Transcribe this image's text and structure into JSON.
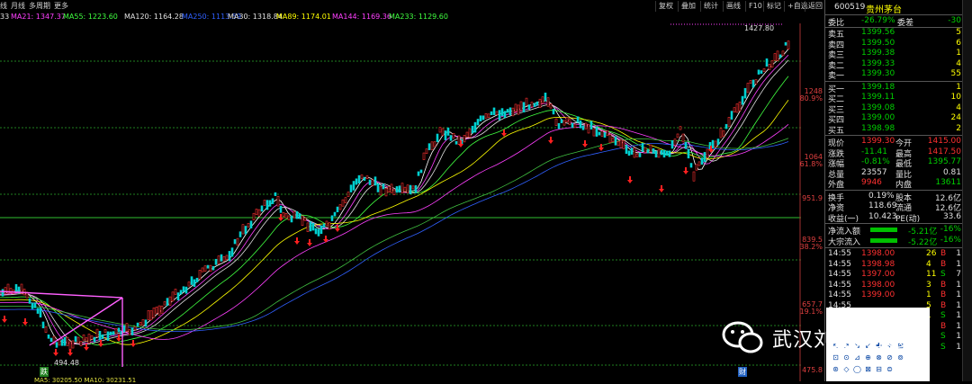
{
  "toolbar": {
    "items": [
      "线",
      "月线",
      "多周期",
      "更多"
    ],
    "right_buttons": [
      "复权",
      "叠加",
      "统计",
      "画线",
      "F10",
      "标记",
      "+自选",
      "返回"
    ]
  },
  "ma_legend": [
    {
      "label": "33",
      "color": "#e0e0e0"
    },
    {
      "label": "MA21: 1347.37",
      "color": "#ff40ff"
    },
    {
      "label": "MA55: 1223.60",
      "color": "#40ff40"
    },
    {
      "label": "MA120: 1164.28",
      "color": "#e0e0e0"
    },
    {
      "label": "MA250: 1113.59",
      "color": "#3060ff"
    },
    {
      "label": "MA30: 1318.84",
      "color": "#e0e0e0"
    },
    {
      "label": "MA89: 1174.01",
      "color": "#ffff00"
    },
    {
      "label": "MA144: 1169.36",
      "color": "#ff40ff"
    },
    {
      "label": "MA233: 1129.60",
      "color": "#40ff40"
    }
  ],
  "price_axis": [
    {
      "value": "1248",
      "pct": "80.9%"
    },
    {
      "value": "1064",
      "pct": "61.8%"
    },
    {
      "value": "951.9",
      "pct": ""
    },
    {
      "value": "839.5",
      "pct": "38.2%"
    },
    {
      "value": "657.7",
      "pct": "19.1%"
    },
    {
      "value": "475.8",
      "pct": ""
    }
  ],
  "chart_labels": {
    "high": "1427.80",
    "low": "494.48",
    "bottom_left": "MA5: 30205.50  MA10: 30231.51",
    "marker_a": "跌",
    "marker_b": "财"
  },
  "quote": {
    "code": "600519",
    "name": "贵州茅台",
    "weibi_label": "委比",
    "weibi": "-26.79%",
    "weicha_label": "委差",
    "weicha": "-30",
    "sells": [
      {
        "label": "卖五",
        "price": "1399.56",
        "vol": "5"
      },
      {
        "label": "卖四",
        "price": "1399.50",
        "vol": "6"
      },
      {
        "label": "卖三",
        "price": "1399.38",
        "vol": "1"
      },
      {
        "label": "卖二",
        "price": "1399.33",
        "vol": "4"
      },
      {
        "label": "卖一",
        "price": "1399.30",
        "vol": "55"
      }
    ],
    "buys": [
      {
        "label": "买一",
        "price": "1399.18",
        "vol": "1"
      },
      {
        "label": "买二",
        "price": "1399.11",
        "vol": "10"
      },
      {
        "label": "买三",
        "price": "1399.08",
        "vol": "4"
      },
      {
        "label": "买四",
        "price": "1399.00",
        "vol": "24"
      },
      {
        "label": "买五",
        "price": "1398.98",
        "vol": "2"
      }
    ],
    "stats": [
      {
        "l1": "现价",
        "v1": "1399.30",
        "l2": "今开",
        "v2": "1415.00",
        "c1": "red",
        "c2": "red"
      },
      {
        "l1": "涨跌",
        "v1": "-11.41",
        "l2": "最高",
        "v2": "1417.50",
        "c1": "green",
        "c2": "red"
      },
      {
        "l1": "涨幅",
        "v1": "-0.81%",
        "l2": "最低",
        "v2": "1395.77",
        "c1": "green",
        "c2": "green"
      },
      {
        "l1": "总量",
        "v1": "23557",
        "l2": "量比",
        "v2": "0.81",
        "c1": "white",
        "c2": "white"
      },
      {
        "l1": "外盘",
        "v1": "9946",
        "l2": "内盘",
        "v2": "13611",
        "c1": "red",
        "c2": "green"
      }
    ],
    "extra": [
      {
        "l1": "换手",
        "v1": "0.19%",
        "l2": "股本",
        "v2": "12.6亿"
      },
      {
        "l1": "净资",
        "v1": "118.69",
        "l2": "流通",
        "v2": "12.6亿"
      },
      {
        "l1": "收益(一)",
        "v1": "10.423",
        "l2": "PE(动)",
        "v2": "33.6"
      }
    ],
    "flows": [
      {
        "label": "净流入额",
        "value": "-5.21亿",
        "pct": "-16%"
      },
      {
        "label": "大宗流入",
        "value": "-5.22亿",
        "pct": "-16%"
      }
    ],
    "ticks": [
      {
        "time": "14:55",
        "price": "1398.00",
        "vol": "26",
        "side": "B",
        "n": "1"
      },
      {
        "time": "14:55",
        "price": "1398.98",
        "vol": "4",
        "side": "B",
        "n": "1"
      },
      {
        "time": "14:55",
        "price": "1397.00",
        "vol": "11",
        "side": "S",
        "n": "7"
      },
      {
        "time": "14:55",
        "price": "1398.00",
        "vol": "3",
        "side": "B",
        "n": "1"
      },
      {
        "time": "14:55",
        "price": "1399.00",
        "vol": "1",
        "side": "B",
        "n": "1"
      },
      {
        "time": "14:55",
        "price": "",
        "vol": "5",
        "side": "B",
        "n": "1"
      },
      {
        "time": "14:55",
        "price": "",
        "vol": "1",
        "side": "S",
        "n": "1"
      },
      {
        "time": "14:55",
        "price": "",
        "vol": "",
        "side": "B",
        "n": "1"
      },
      {
        "time": "14:55",
        "price": "",
        "vol": "",
        "side": "S",
        "n": "1"
      },
      {
        "time": "14:55",
        "price": "",
        "vol": "",
        "side": "S",
        "n": "1"
      }
    ]
  },
  "watermark": {
    "text": "武汉刘正涛投资"
  },
  "colors": {
    "up": "#ff3030",
    "down": "#00d000",
    "bg": "#000000"
  }
}
